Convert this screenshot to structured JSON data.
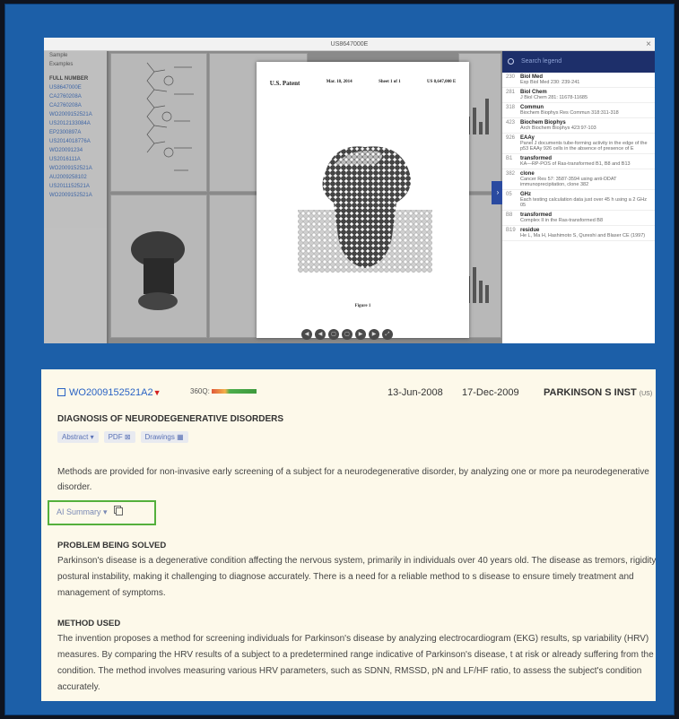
{
  "viewer": {
    "title": "US8647000E",
    "close_label": "×",
    "left_panel": {
      "items": [
        "Sample",
        "Examples"
      ],
      "family_header": "FULL NUMBER",
      "links": [
        "US8647000E",
        "CA2760208A",
        "CA2760208A",
        "WO2009152521A",
        "US2012133084A",
        "EP2300897A",
        "US2014018776A",
        "WO20091234",
        "US2016111A",
        "WO2009152521A",
        "AU2009258102",
        "US2011152521A",
        "WO2009152521A"
      ]
    },
    "page": {
      "header_left": "U.S. Patent",
      "header_date": "Mar. 18, 2014",
      "header_sheet": "Sheet 1 of 1",
      "header_number": "US 8,647,000 E",
      "figure_caption": "Figure 1"
    },
    "pager": [
      "◀",
      "◀",
      "▢",
      "▢",
      "▶",
      "▶",
      "⤢"
    ],
    "legend": {
      "search_placeholder": "Search legend",
      "items": [
        {
          "num": "230",
          "term": "Biol Med",
          "desc": "Exp Biol Med 230: 239-241"
        },
        {
          "num": "281",
          "term": "Biol Chem",
          "desc": "J Biol Chem 281: 11678-11685"
        },
        {
          "num": "318",
          "term": "Commun",
          "desc": "Biochem Biophys Res Commun 318:311-318"
        },
        {
          "num": "423",
          "term": "Biochem Biophys",
          "desc": "Arch Biochem Biophys 423:97-103"
        },
        {
          "num": "926",
          "term": "EAAy",
          "desc": "Panel J documents tube-forming activity in the edge of the p53 EAAy 926 cells in the absence of presence of E"
        },
        {
          "num": "B1",
          "term": "transformed",
          "desc": "KA—RP-POS of Ras-transformed B1, B8 and B13"
        },
        {
          "num": "382",
          "term": "clone",
          "desc": "Cancer Res 57: 3587-3594 using anti-DDAT immunoprecipitation, clone 382"
        },
        {
          "num": "05",
          "term": "GHz",
          "desc": "Each testing calculation data just over 45 h using a 2 GHz 05"
        },
        {
          "num": "B8",
          "term": "transformed",
          "desc": "Complex II in the Ras-transformed B8"
        },
        {
          "num": "B19",
          "term": "residue",
          "desc": "He L, Ma H, Hashimoto S, Qureshi and Blaser CE (1997)"
        }
      ]
    }
  },
  "result": {
    "patent_number": "WO2009152521A2",
    "status_icon": "▼",
    "quality_label": "360Q:",
    "quality_value": 0.7,
    "priority_date": "13-Jun-2008",
    "publication_date": "17-Dec-2009",
    "assignee": "PARKINSON S INST",
    "assignee_country": "(US)",
    "title": "DIAGNOSIS OF NEURODEGENERATIVE DISORDERS",
    "pills": [
      "Abstract ▾",
      "PDF ⊠",
      "Drawings ▦"
    ],
    "abstract": "Methods are provided for non-invasive early screening of a subject for a neurodegenerative disorder, by analyzing one or more pa neurodegenerative disorder.",
    "ai_summary_label": "AI Summary ▾",
    "problem_heading": "PROBLEM BEING SOLVED",
    "problem_text": "Parkinson's disease is a degenerative condition affecting the nervous system, primarily in individuals over 40 years old. The disease as tremors, rigidity, and postural instability, making it challenging to diagnose accurately. There is a need for a reliable method to s disease to ensure timely treatment and management of symptoms.",
    "method_heading": "METHOD USED",
    "method_text": "The invention proposes a method for screening individuals for Parkinson's disease by analyzing electrocardiogram (EKG) results, sp variability (HRV) measures. By comparing the HRV results of a subject to a predetermined range indicative of Parkinson's disease, t at risk or already suffering from the condition. The method involves measuring various HRV parameters, such as SDNN, RMSSD, pN and LF/HF ratio, to assess the subject's condition accurately."
  }
}
